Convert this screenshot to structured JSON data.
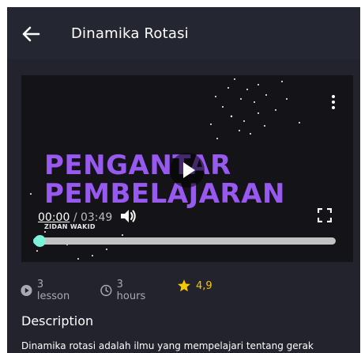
{
  "appbar": {
    "title": "Dinamika Rotasi",
    "back_icon": "arrow-left-icon"
  },
  "video": {
    "headline_line1": "PENGANTAR",
    "headline_line2": "PEMBELAJARAN",
    "author": "ZIDAN WAKID",
    "current_time": "00:00",
    "total_time": "/ 03:49",
    "progress": 0.0,
    "headline_color": "#9859f0",
    "accent_color": "#6ee0c8",
    "icons": [
      "more-vertical-icon",
      "play-icon",
      "volume-icon",
      "fullscreen-icon"
    ]
  },
  "stats": {
    "lessons": "3 lesson",
    "duration": "3 hours",
    "rating": "4,9",
    "rating_color": "#f7c800"
  },
  "description": {
    "title": "Description",
    "text": "Dinamika rotasi adalah ilmu yang mempelajari tentang gerak"
  }
}
